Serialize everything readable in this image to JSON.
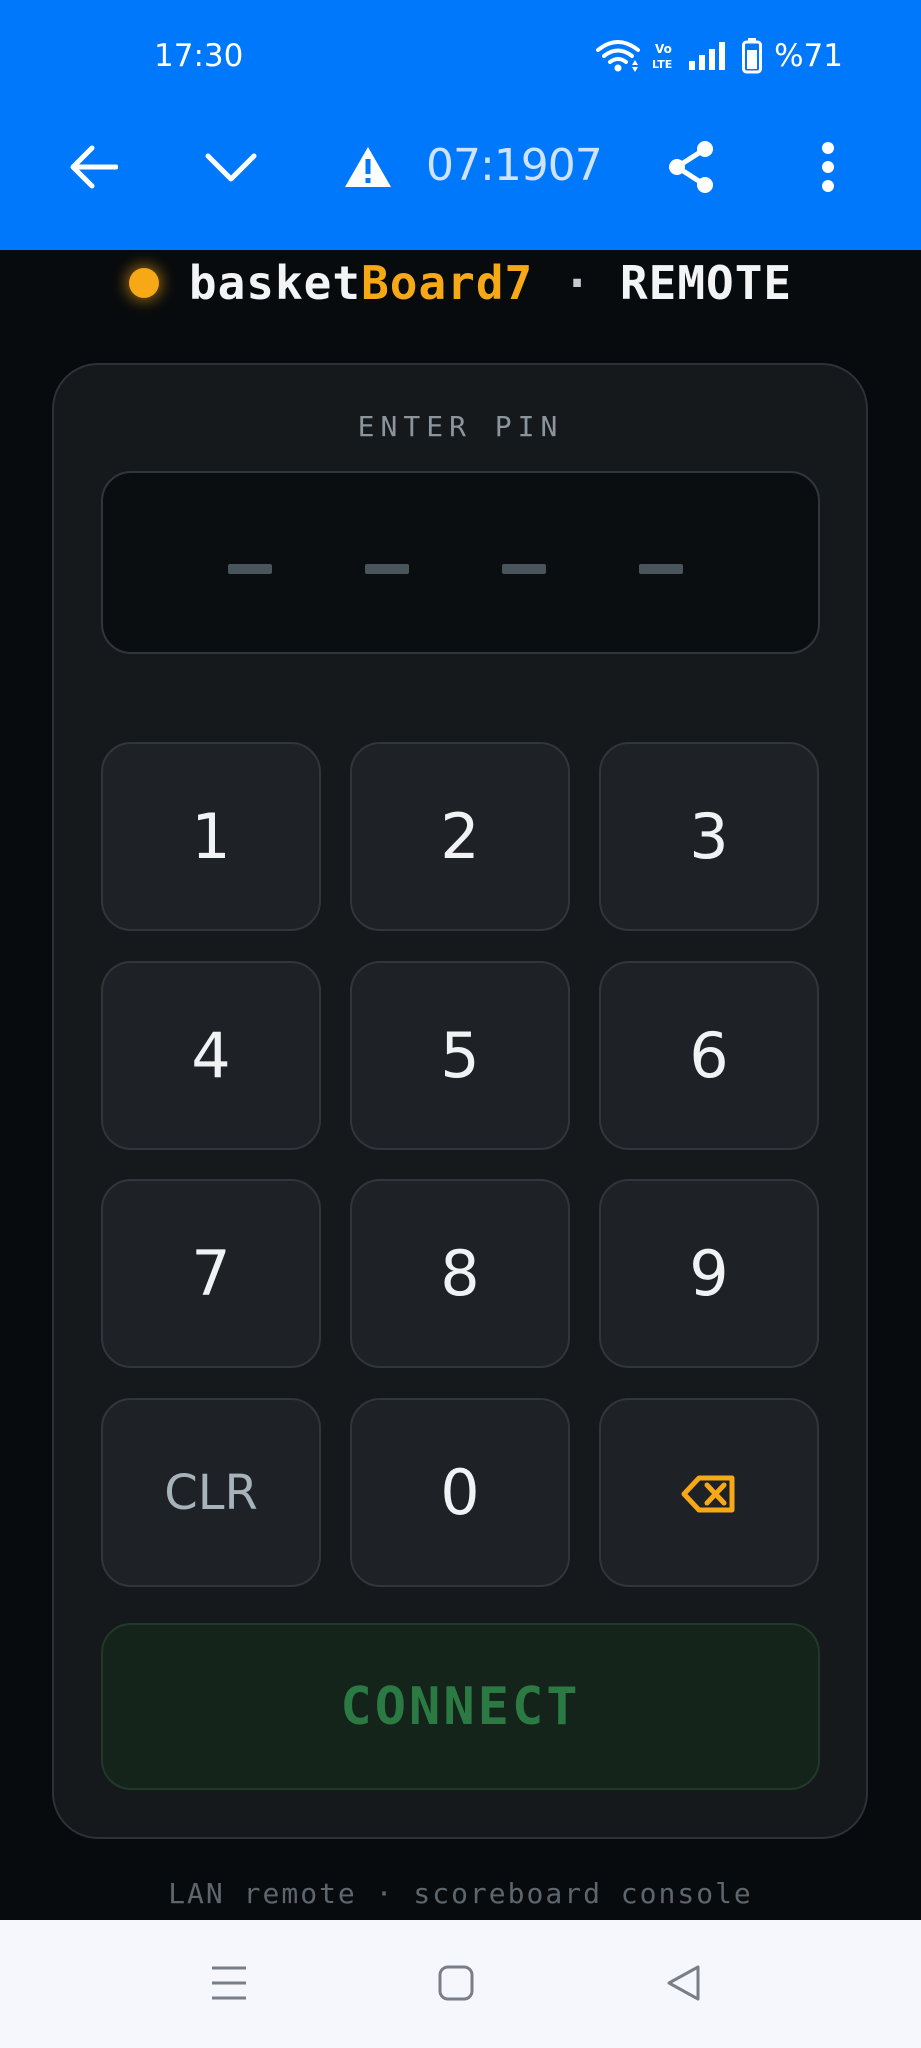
{
  "status_bar": {
    "time": "17:30",
    "volte": "Vo\nLTE",
    "battery_label": "%71",
    "battery_level_percent": 71,
    "icons": [
      "wifi-icon",
      "volte-icon",
      "signal-icon",
      "battery-icon"
    ]
  },
  "browser": {
    "url": "07:1907",
    "icons": [
      "back-arrow-icon",
      "chevron-down-icon",
      "warning-icon",
      "share-icon",
      "more-vert-icon"
    ]
  },
  "header": {
    "brand_main": "basket",
    "brand_accent": "Board7",
    "separator": "·",
    "mode": "REMOTE"
  },
  "pin": {
    "label": "ENTER PIN",
    "digits": 4,
    "placeholder_char": "–"
  },
  "keypad": {
    "keys": [
      "1",
      "2",
      "3",
      "4",
      "5",
      "6",
      "7",
      "8",
      "9",
      "CLR",
      "0"
    ],
    "backspace_icon": "backspace-icon"
  },
  "connect_label": "CONNECT",
  "footer": "LAN remote · scoreboard console",
  "nav_bar": {
    "icons": [
      "recents-icon",
      "home-icon",
      "back-icon"
    ]
  },
  "colors": {
    "accent": "#f7a816",
    "browser_bar": "#0078fb",
    "background": "#080b0d",
    "connect_text": "#2c7a43"
  }
}
